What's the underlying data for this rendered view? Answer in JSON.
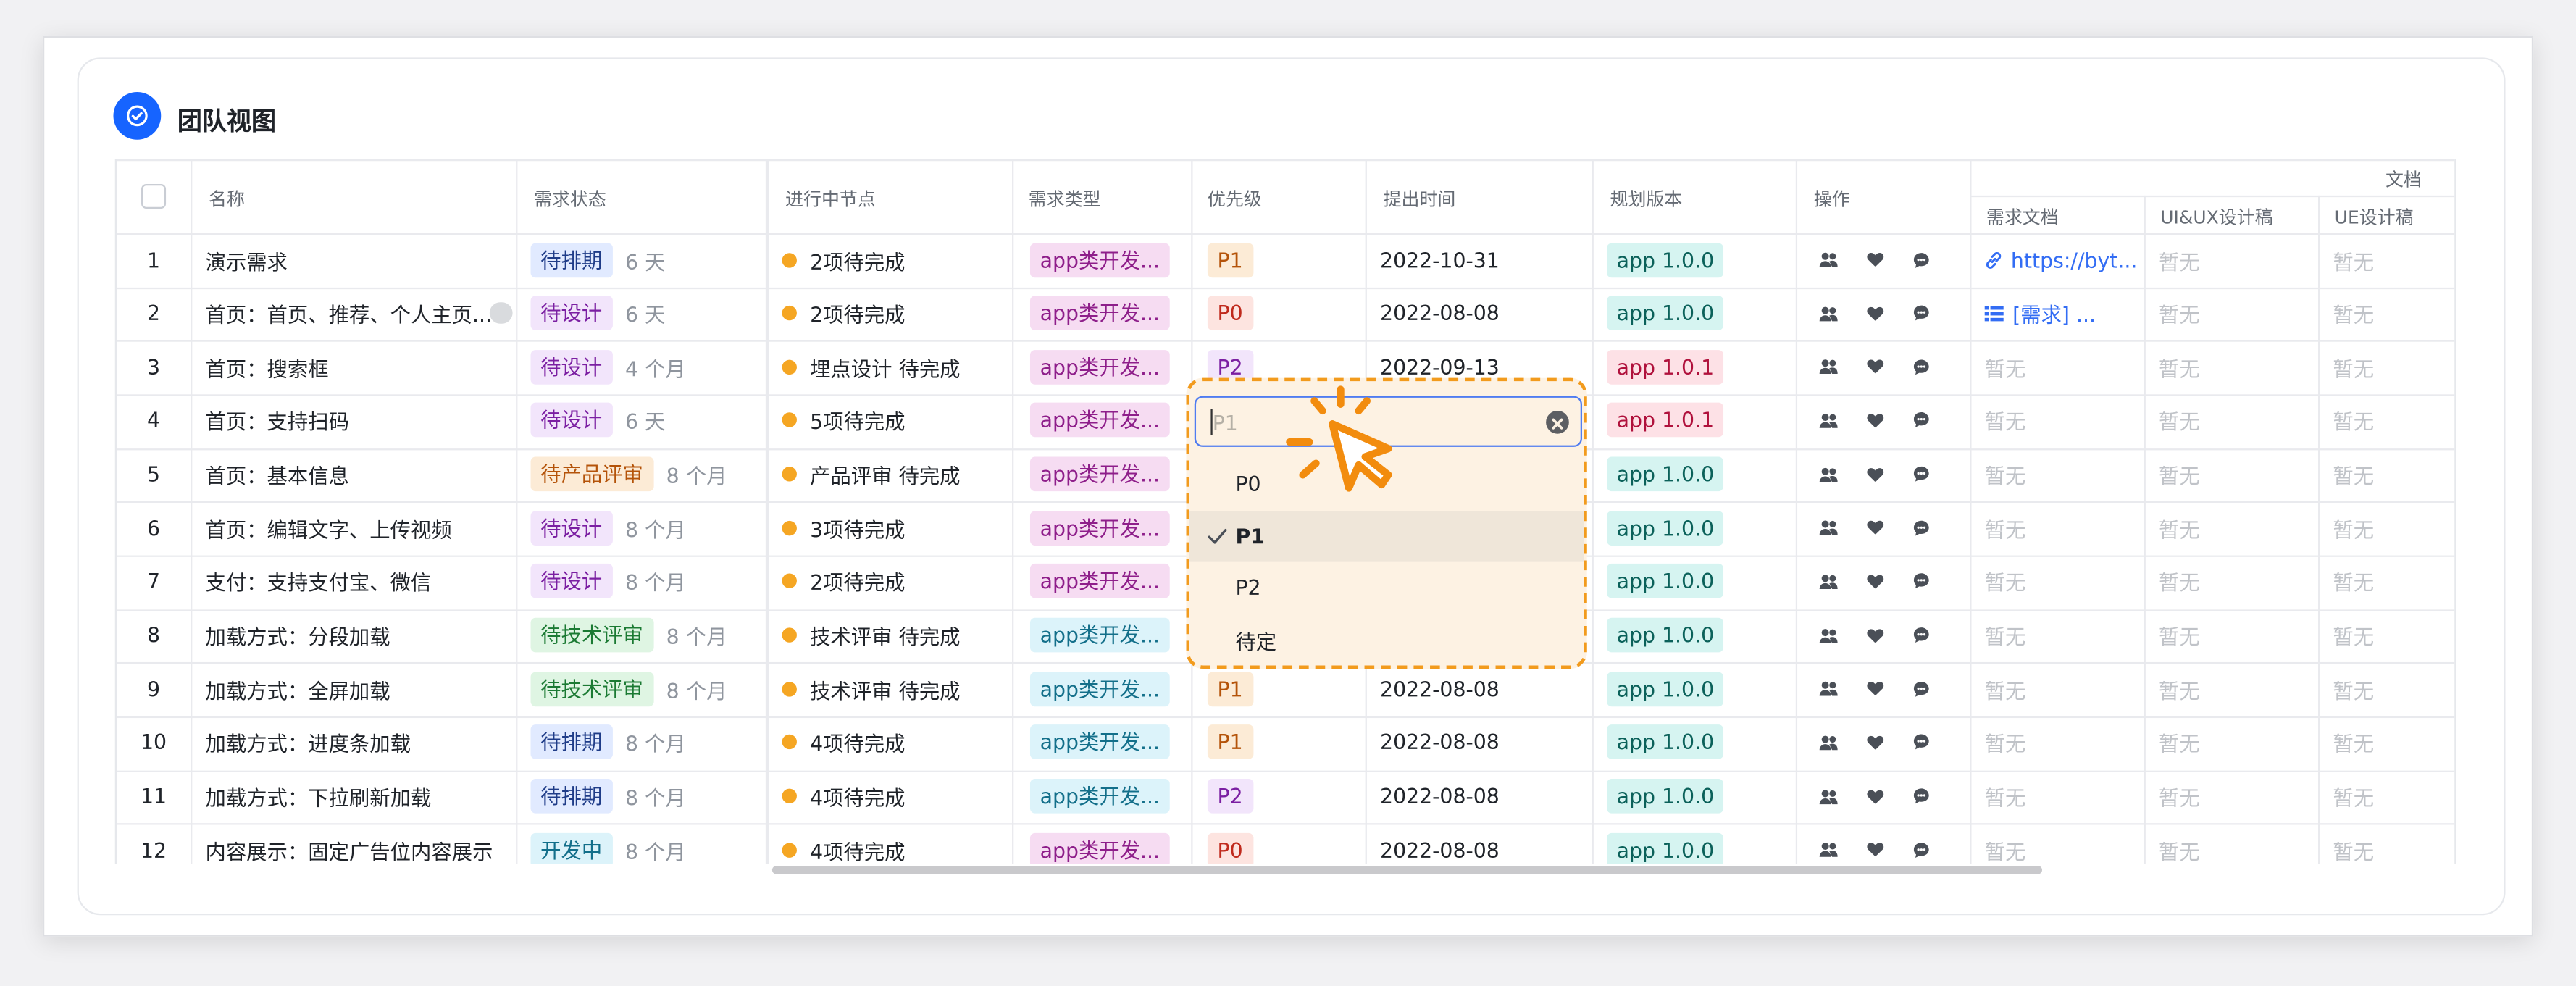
{
  "view_title": "团队视图",
  "columns": {
    "name": "名称",
    "status": "需求状态",
    "node": "进行中节点",
    "type": "需求类型",
    "priority": "优先级",
    "date": "提出时间",
    "version": "规划版本",
    "ops": "操作",
    "docs_group": "文档",
    "doc_req": "需求文档",
    "doc_uiux": "UI&UX设计稿",
    "doc_ue": "UE设计稿"
  },
  "empty_text": "暂无",
  "rows": [
    {
      "no": "1",
      "name": "演示需求",
      "status": "待排期",
      "status_style": "blue",
      "age": "6 天",
      "node": "2项待完成",
      "type": "app类开发...",
      "type_style": "pink",
      "priority": "P1",
      "priority_style": "orange",
      "date": "2022-10-31",
      "version": "app 1.0.0",
      "version_style": "teal",
      "doc": "https://byt...",
      "doc_icon": "link"
    },
    {
      "no": "2",
      "name": "首页：首页、推荐、个人主页...",
      "status": "待设计",
      "status_style": "purple",
      "age": "6 天",
      "node": "2项待完成",
      "type": "app类开发...",
      "type_style": "pink",
      "priority": "P0",
      "priority_style": "red",
      "date": "2022-08-08",
      "version": "app 1.0.0",
      "version_style": "teal",
      "doc": "[需求] ...",
      "doc_icon": "list"
    },
    {
      "no": "3",
      "name": "首页：搜索框",
      "status": "待设计",
      "status_style": "purple",
      "age": "4 个月",
      "node": "埋点设计 待完成",
      "type": "app类开发...",
      "type_style": "pink",
      "priority": "P2",
      "priority_style": "purple",
      "date": "2022-09-13",
      "version": "app 1.0.1",
      "version_style": "rose",
      "doc": ""
    },
    {
      "no": "4",
      "name": "首页：支持扫码",
      "status": "待设计",
      "status_style": "purple",
      "age": "6 天",
      "node": "5项待完成",
      "type": "app类开发...",
      "type_style": "pink",
      "priority": "",
      "priority_style": "orange",
      "date": "",
      "version": "app 1.0.1",
      "version_style": "rose",
      "doc": ""
    },
    {
      "no": "5",
      "name": "首页：基本信息",
      "status": "待产品评审",
      "status_style": "orange",
      "age": "8 个月",
      "node": "产品评审 待完成",
      "type": "app类开发...",
      "type_style": "pink",
      "priority": "",
      "priority_style": "orange",
      "date": "",
      "version": "app 1.0.0",
      "version_style": "teal",
      "doc": ""
    },
    {
      "no": "6",
      "name": "首页：编辑文字、上传视频",
      "status": "待设计",
      "status_style": "purple",
      "age": "8 个月",
      "node": "3项待完成",
      "type": "app类开发...",
      "type_style": "pink",
      "priority": "",
      "priority_style": "orange",
      "date": "",
      "version": "app 1.0.0",
      "version_style": "teal",
      "doc": ""
    },
    {
      "no": "7",
      "name": "支付：支持支付宝、微信",
      "status": "待设计",
      "status_style": "purple",
      "age": "8 个月",
      "node": "2项待完成",
      "type": "app类开发...",
      "type_style": "pink",
      "priority": "",
      "priority_style": "orange",
      "date": "",
      "version": "app 1.0.0",
      "version_style": "teal",
      "doc": ""
    },
    {
      "no": "8",
      "name": "加载方式：分段加载",
      "status": "待技术评审",
      "status_style": "green",
      "age": "8 个月",
      "node": "技术评审 待完成",
      "type": "app类开发...",
      "type_style": "cyan",
      "priority": "",
      "priority_style": "orange",
      "date": "",
      "version": "app 1.0.0",
      "version_style": "teal",
      "doc": ""
    },
    {
      "no": "9",
      "name": "加载方式：全屏加载",
      "status": "待技术评审",
      "status_style": "green",
      "age": "8 个月",
      "node": "技术评审 待完成",
      "type": "app类开发...",
      "type_style": "cyan",
      "priority": "P1",
      "priority_style": "orange",
      "date": "2022-08-08",
      "version": "app 1.0.0",
      "version_style": "teal",
      "doc": ""
    },
    {
      "no": "10",
      "name": "加载方式：进度条加载",
      "status": "待排期",
      "status_style": "blue",
      "age": "8 个月",
      "node": "4项待完成",
      "type": "app类开发...",
      "type_style": "cyan",
      "priority": "P1",
      "priority_style": "orange",
      "date": "2022-08-08",
      "version": "app 1.0.0",
      "version_style": "teal",
      "doc": ""
    },
    {
      "no": "11",
      "name": "加载方式：下拉刷新加载",
      "status": "待排期",
      "status_style": "blue",
      "age": "8 个月",
      "node": "4项待完成",
      "type": "app类开发...",
      "type_style": "cyan",
      "priority": "P2",
      "priority_style": "purple",
      "date": "2022-08-08",
      "version": "app 1.0.0",
      "version_style": "teal",
      "doc": ""
    },
    {
      "no": "12",
      "name": "内容展示：固定广告位内容展示",
      "status": "开发中",
      "status_style": "cyan",
      "age": "8 个月",
      "node": "4项待完成",
      "type": "app类开发...",
      "type_style": "pink",
      "priority": "P0",
      "priority_style": "red",
      "date": "2022-08-08",
      "version": "app 1.0.0",
      "version_style": "teal",
      "doc": ""
    }
  ],
  "priority_dropdown": {
    "input_placeholder": "P1",
    "options": [
      "P0",
      "P1",
      "P2",
      "待定"
    ],
    "selected": "P1"
  },
  "icons": [
    "check-circle-icon",
    "people-icon",
    "heart-icon",
    "comment-icon",
    "link-icon",
    "list-icon",
    "clear-icon",
    "check-icon",
    "pointer-cursor-icon"
  ],
  "colors": {
    "accent": "#1664ff",
    "highlight": "#f29b1d",
    "dropdown_bg": "#fdf2e3"
  }
}
